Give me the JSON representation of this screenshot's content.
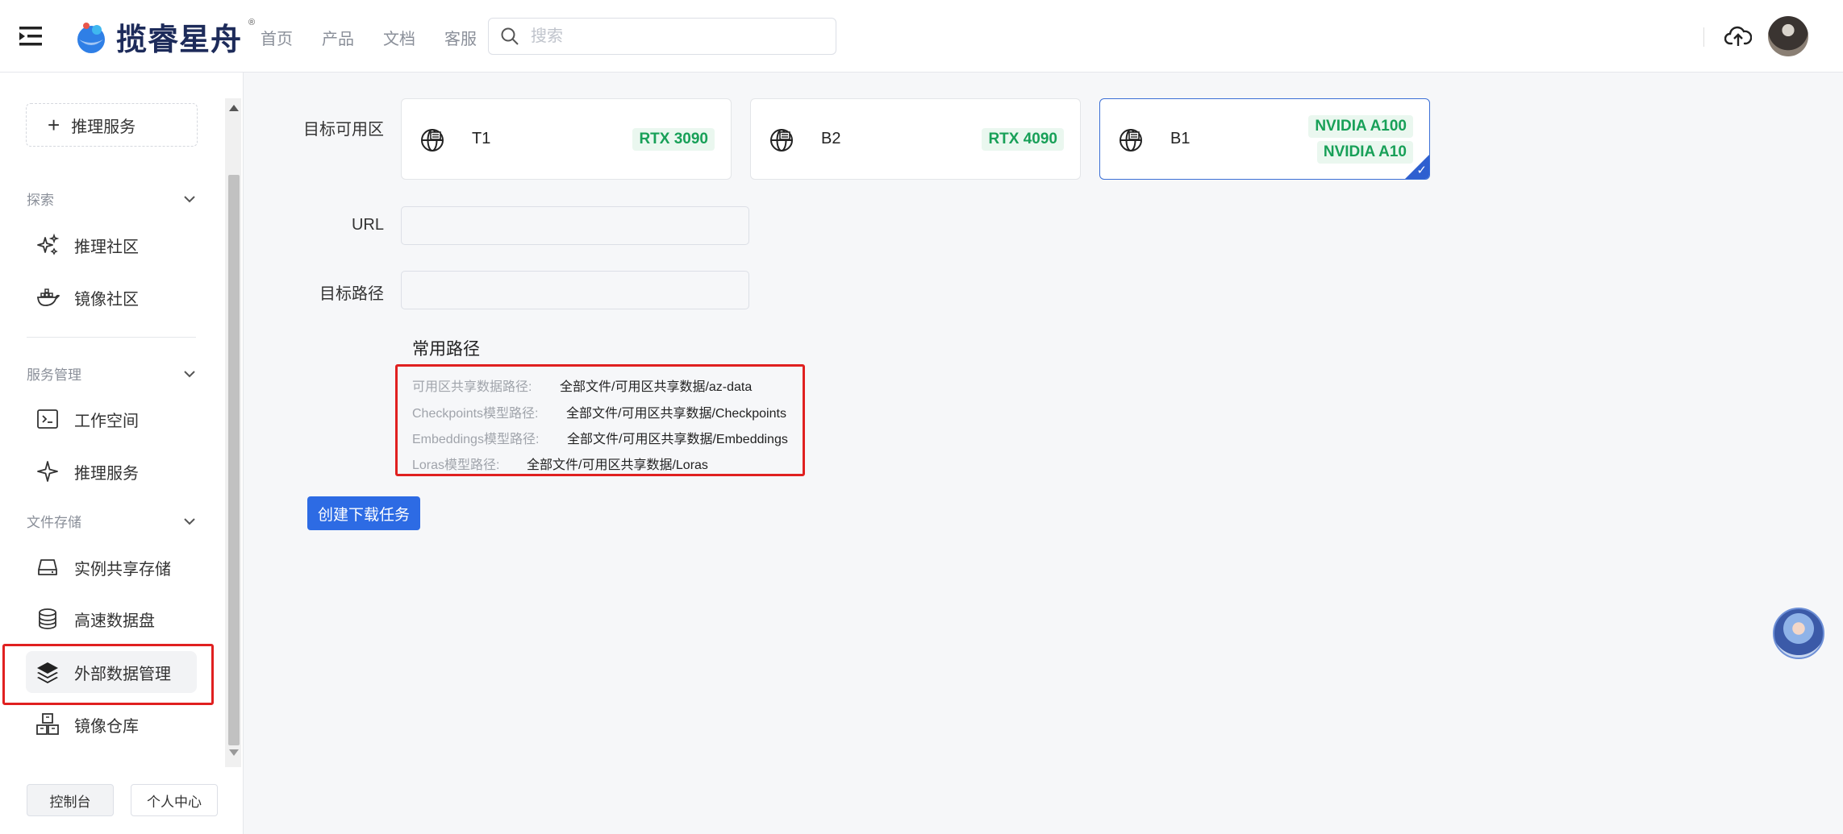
{
  "header": {
    "logo_text": "揽睿星舟",
    "logo_reg": "®",
    "nav": [
      "首页",
      "产品",
      "文档",
      "客服"
    ],
    "search_placeholder": "搜索"
  },
  "sidebar": {
    "add_button": "推理服务",
    "sections": [
      {
        "title": "探索",
        "items": [
          "推理社区",
          "镜像社区"
        ]
      },
      {
        "title": "服务管理",
        "items": [
          "工作空间",
          "推理服务"
        ]
      },
      {
        "title": "文件存储",
        "items": [
          "实例共享存储",
          "高速数据盘",
          "外部数据管理",
          "镜像仓库"
        ]
      }
    ],
    "bottom_buttons": [
      "控制台",
      "个人中心"
    ]
  },
  "form": {
    "zone_label": "目标可用区",
    "zones": [
      {
        "name": "T1",
        "gpus": [
          "RTX 3090"
        ],
        "selected": false
      },
      {
        "name": "B2",
        "gpus": [
          "RTX 4090"
        ],
        "selected": false
      },
      {
        "name": "B1",
        "gpus": [
          "NVIDIA A100",
          "NVIDIA A10"
        ],
        "selected": true
      }
    ],
    "url_label": "URL",
    "url_value": "",
    "path_label": "目标路径",
    "path_value": "",
    "common_paths_title": "常用路径",
    "common_paths": [
      {
        "key": "可用区共享数据路径:",
        "value": "全部文件/可用区共享数据/az-data"
      },
      {
        "key": "Checkpoints模型路径:",
        "value": "全部文件/可用区共享数据/Checkpoints"
      },
      {
        "key": "Embeddings模型路径:",
        "value": "全部文件/可用区共享数据/Embeddings"
      },
      {
        "key": "Loras模型路径:",
        "value": "全部文件/可用区共享数据/Loras"
      }
    ],
    "submit_button": "创建下载任务"
  },
  "colors": {
    "accent": "#2d6be4",
    "tag_green": "#18a058",
    "highlight_red": "#e02020"
  }
}
